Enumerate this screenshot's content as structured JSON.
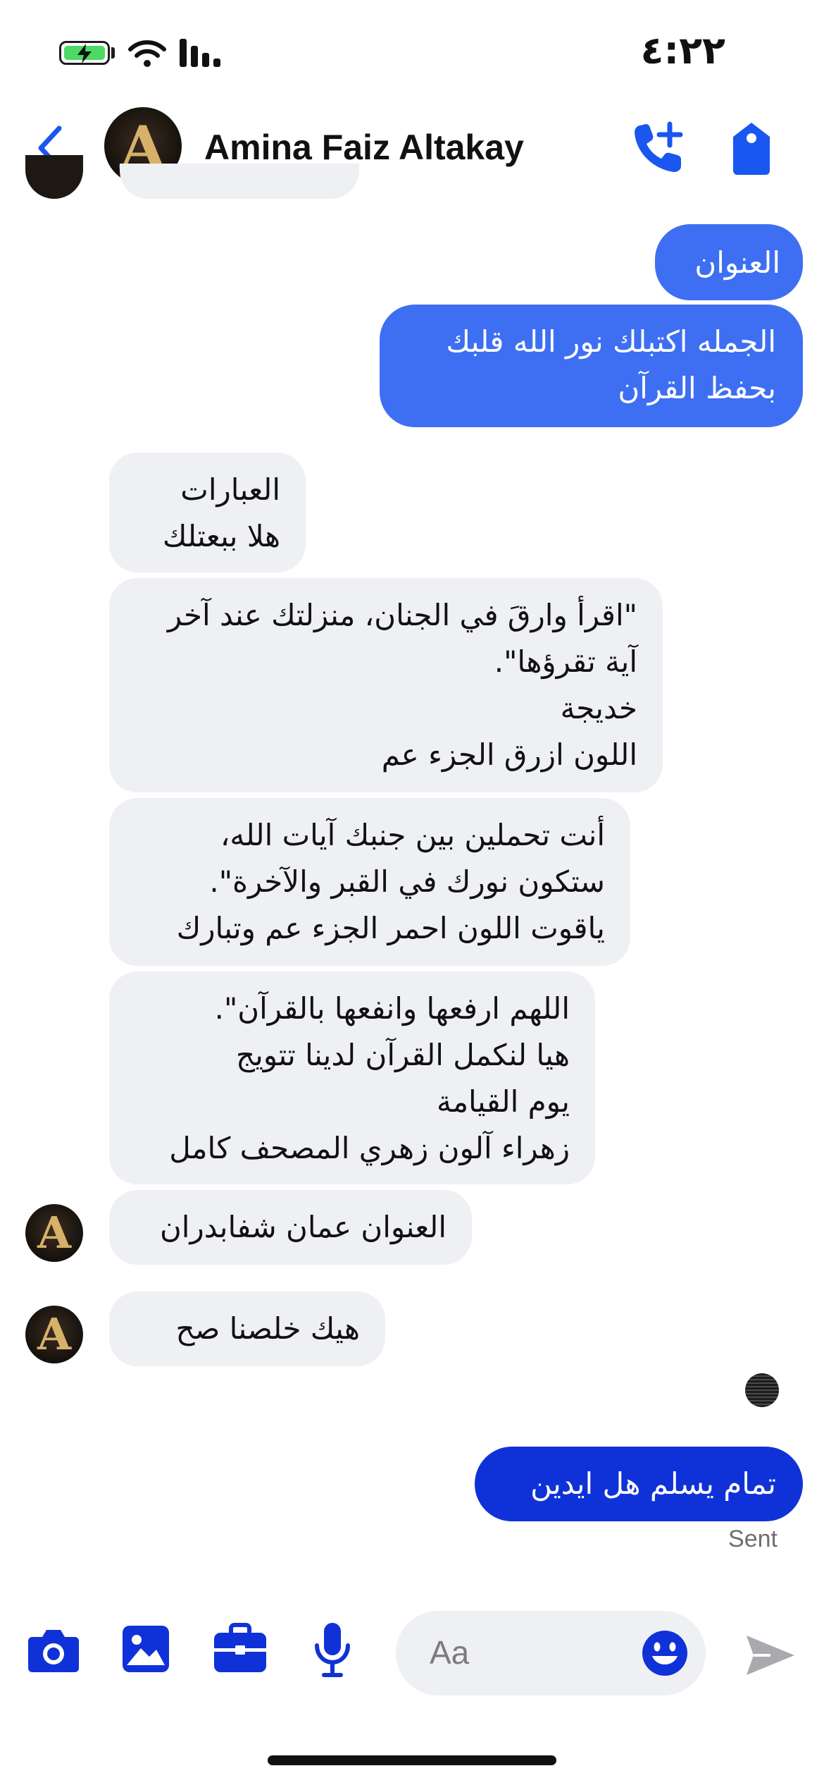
{
  "status_bar": {
    "time": "٤:٢٢",
    "battery_icon": "battery-charging-icon",
    "wifi_icon": "wifi-icon",
    "signal_icon": "cellular-signal-icon"
  },
  "header": {
    "contact_name": "Amina Faiz Altakay",
    "avatar_letter": "A",
    "back_icon": "chevron-left-icon",
    "call_icon": "phone-add-icon",
    "tag_icon": "tag-icon"
  },
  "messages": [
    {
      "direction": "out",
      "text": "العنوان"
    },
    {
      "direction": "out",
      "text": "الجمله اكتبلك نور الله قلبك\nبحفظ القرآن"
    },
    {
      "direction": "in",
      "text": "العبارات\nهلا ببعتلك"
    },
    {
      "direction": "in",
      "text": "\"اقرأ وارقَ في الجنان، منزلتك عند آخر\nآية تقرؤها\".\nخديجة\nاللون ازرق الجزء عم"
    },
    {
      "direction": "in",
      "text": "أنت تحملين بين جنبك آيات الله،\nستكون نورك في القبر والآخرة\".\nياقوت اللون احمر الجزء عم وتبارك"
    },
    {
      "direction": "in",
      "text": "اللهم ارفعها وانفعها بالقرآن\".\nهيا لنكمل القرآن لدينا تتويج\nيوم القيامة\nزهراء آلون زهري المصحف كامل"
    },
    {
      "direction": "in",
      "text": "العنوان عمان شفابدران"
    },
    {
      "direction": "in",
      "text": "هيك خلصنا صح"
    },
    {
      "direction": "out",
      "text": "تمام يسلم هل ايدين"
    }
  ],
  "sent_status": "Sent",
  "composer": {
    "placeholder": "Aa",
    "camera_icon": "camera-icon",
    "gallery_icon": "image-icon",
    "briefcase_icon": "briefcase-icon",
    "mic_icon": "microphone-icon",
    "emoji_icon": "smiley-icon",
    "send_icon": "send-icon"
  },
  "colors": {
    "accent": "#1a56f0",
    "outgoing_bubble": "#3e6ff3",
    "outgoing_bubble_latest": "#0f32d8",
    "incoming_bubble": "#eff0f3"
  }
}
